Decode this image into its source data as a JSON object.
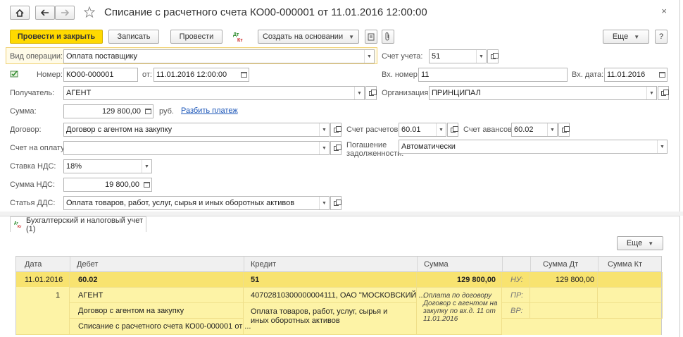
{
  "window": {
    "title": "Списание с расчетного счета КО00-000001 от 11.01.2016 12:00:00",
    "home_icon": "home-icon",
    "back_icon": "arrow-left-icon",
    "forward_icon": "arrow-right-icon",
    "favorite_icon": "star-icon",
    "close_glyph": "×"
  },
  "toolbar": {
    "post_close": "Провести и закрыть",
    "save": "Записать",
    "post": "Провести",
    "dt_kt_icon": "Дт Кт",
    "create_based": "Создать на основании",
    "more": "Еще",
    "help": "?"
  },
  "form": {
    "operation_label": "Вид операции:",
    "operation_value": "Оплата поставщику",
    "account_label": "Счет учета:",
    "account_value": "51",
    "number_label": "Номер:",
    "number_value": "КО00-000001",
    "from_label": "от:",
    "from_value": "11.01.2016 12:00:00",
    "in_number_label": "Вх. номер:",
    "in_number_value": "11",
    "in_date_label": "Вх. дата:",
    "in_date_value": "11.01.2016",
    "recipient_label": "Получатель:",
    "recipient_value": "АГЕНТ",
    "org_label": "Организация:",
    "org_value": "ПРИНЦИПАЛ",
    "sum_label": "Сумма:",
    "sum_value": "129 800,00",
    "currency": "руб.",
    "split_link": "Разбить платеж",
    "contract_label": "Договор:",
    "contract_value": "Договор с агентом на закупку",
    "settle_label": "Счет расчетов:",
    "settle_value": "60.01",
    "advance_label": "Счет авансов:",
    "advance_value": "60.02",
    "invoice_label": "Счет на оплату:",
    "invoice_value": "",
    "repay_label_1": "Погашение",
    "repay_label_2": "задолженности:",
    "repay_value": "Автоматически",
    "vat_rate_label": "Ставка НДС:",
    "vat_rate_value": "18%",
    "vat_sum_label": "Сумма НДС:",
    "vat_sum_value": "19 800,00",
    "dds_label": "Статья ДДС:",
    "dds_value": "Оплата товаров, работ, услуг, сырья и иных оборотных активов"
  },
  "tab": {
    "label": "Бухгалтерский и налоговый учет (1)",
    "more": "Еще"
  },
  "table": {
    "headers": [
      "Дата",
      "Дебет",
      "Кредит",
      "Сумма",
      "Сумма Дт",
      "Сумма Кт"
    ],
    "row": {
      "date": "11.01.2016",
      "num": "1",
      "debit": "60.02",
      "debit_sub1": "АГЕНТ",
      "debit_sub2": "Договор с агентом на закупку",
      "debit_sub3": "Списание с расчетного счета КО00-000001 от ...",
      "credit": "51",
      "credit_sub1": "40702810300000004111, ОАО \"МОСКОВСКИЙ ...",
      "credit_sub2": "Оплата товаров, работ, услуг, сырья и иных оборотных активов",
      "sum": "129 800,00",
      "content": "Оплата по договору Договор с агентом на закупку по вх.д. 11 от 11.01.2016",
      "nu": "НУ:",
      "pr": "ПР:",
      "vr": "ВР:",
      "sum_dt": "129 800,00",
      "sum_kt": ""
    }
  }
}
